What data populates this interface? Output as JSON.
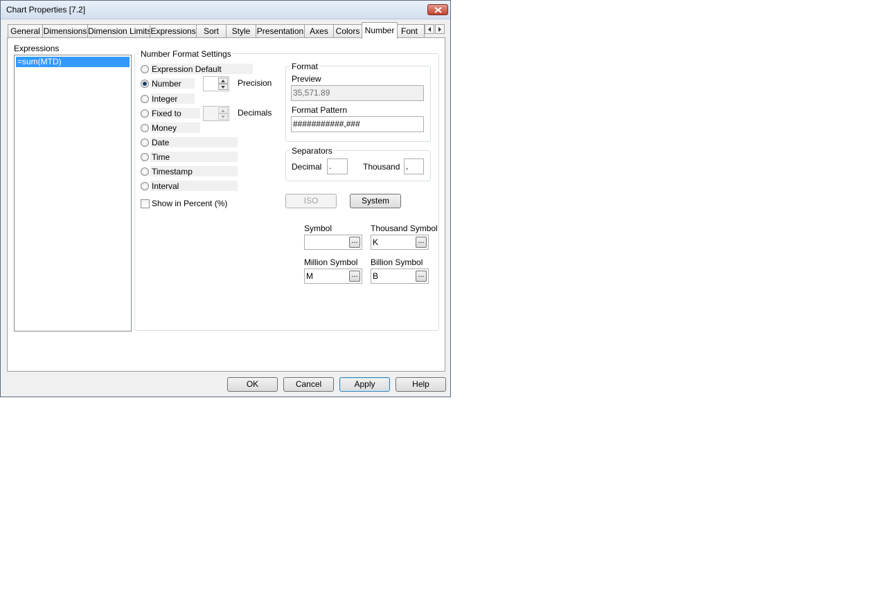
{
  "window": {
    "title": "Chart Properties [7.2]"
  },
  "tabs": [
    {
      "label": "General"
    },
    {
      "label": "Dimensions"
    },
    {
      "label": "Dimension Limits"
    },
    {
      "label": "Expressions"
    },
    {
      "label": "Sort"
    },
    {
      "label": "Style"
    },
    {
      "label": "Presentation"
    },
    {
      "label": "Axes"
    },
    {
      "label": "Colors"
    },
    {
      "label": "Number",
      "active": true
    },
    {
      "label": "Font"
    }
  ],
  "expressions": {
    "label": "Expressions",
    "items": [
      "=sum(MTD)"
    ]
  },
  "number_format": {
    "group_label": "Number Format Settings",
    "options": [
      "Expression Default",
      "Number",
      "Integer",
      "Fixed to",
      "Money",
      "Date",
      "Time",
      "Timestamp",
      "Interval"
    ],
    "selected": "Number",
    "precision_label": "Precision",
    "decimals_label": "Decimals",
    "show_percent_label": "Show in Percent (%)"
  },
  "format": {
    "group_label": "Format",
    "preview_label": "Preview",
    "preview_value": "35,571.89",
    "pattern_label": "Format Pattern",
    "pattern_value": "###########,###"
  },
  "separators": {
    "group_label": "Separators",
    "decimal_label": "Decimal",
    "decimal_value": ".",
    "thousand_label": "Thousand",
    "thousand_value": ","
  },
  "buttons": {
    "iso": "ISO",
    "system": "System",
    "ok": "OK",
    "cancel": "Cancel",
    "apply": "Apply",
    "help": "Help",
    "browse": "..."
  },
  "symbols": {
    "symbol_label": "Symbol",
    "symbol_value": "",
    "thousand_label": "Thousand Symbol",
    "thousand_value": "K",
    "million_label": "Million Symbol",
    "million_value": "M",
    "billion_label": "Billion Symbol",
    "billion_value": "B"
  }
}
